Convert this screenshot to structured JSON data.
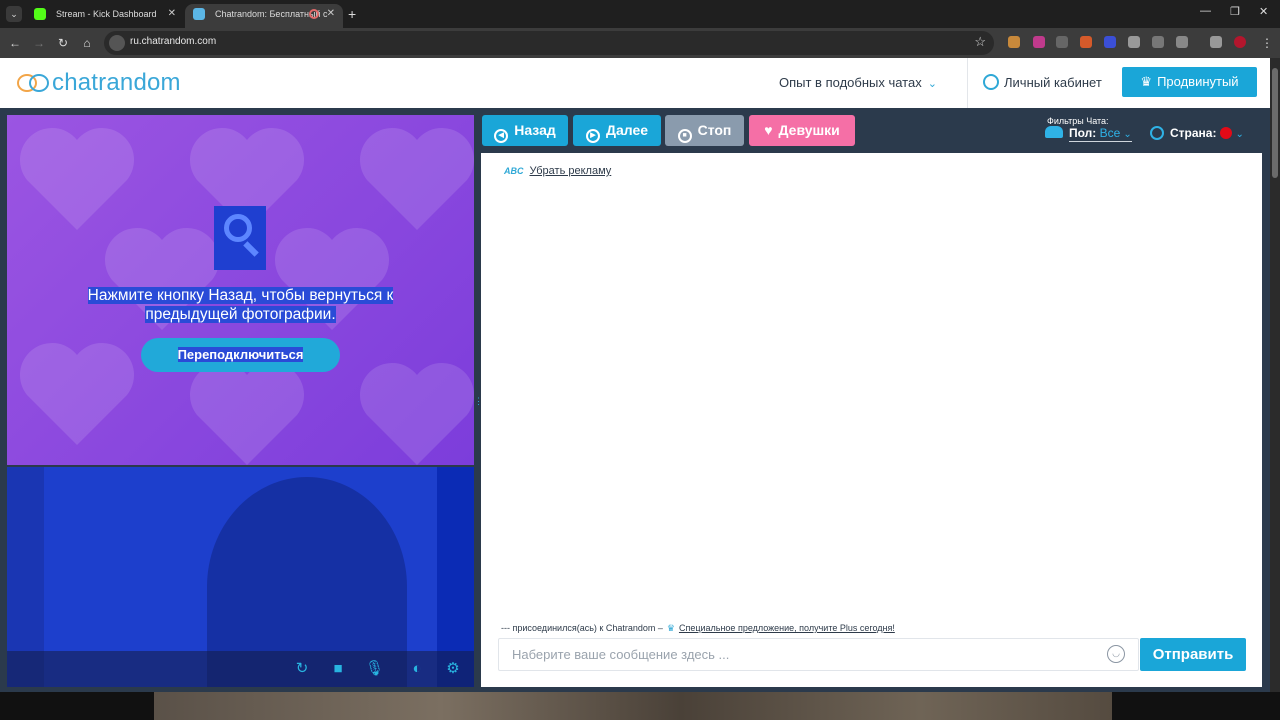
{
  "browser": {
    "tabs": [
      {
        "title": "Stream - Kick Dashboard",
        "favicon_color": "#53fc18",
        "active": false
      },
      {
        "title": "Chatrandom: Бесплатный с",
        "favicon_color": "#5bb6e6",
        "active": true
      }
    ],
    "url": "ru.chatrandom.com"
  },
  "header": {
    "logo_text": "chatrandom",
    "experience_menu": "Опыт в подобных чатах",
    "cabinet": "Личный кабинет",
    "advanced_button": "Продвинутый"
  },
  "video": {
    "remote_message_line1": "Нажмите кнопку Назад, чтобы вернуться к",
    "remote_message_line2": "предыдущей фотографии.",
    "reconnect_button": "Переподключиться",
    "controls": [
      "reconnect-icon",
      "camera-icon",
      "microphone-icon",
      "mask-icon",
      "settings-icon"
    ]
  },
  "chat_controls": {
    "back": "Назад",
    "next": "Далее",
    "stop": "Стоп",
    "girls": "Девушки",
    "filters_label": "Фильтры Чата:",
    "gender_label": "Пол:",
    "gender_value": "Все",
    "country_label": "Страна:"
  },
  "chat": {
    "remove_ads": "Убрать рекламу",
    "system_message": "--- присоединился(ась) к Chatrandom –",
    "offer_link": "Специальное предложение, получите Plus сегодня!",
    "input_placeholder": "Наберите ваше сообщение здесь ...",
    "send_button": "Отправить"
  },
  "colors": {
    "accent": "#1aa6d8",
    "back_button": "#1aa6d8",
    "next_button": "#1aa6d8",
    "stop_button": "#8a9bad",
    "girls_button": "#f56fa6",
    "remote_bg": "#8b48e0",
    "local_bg": "#1d3fcc"
  }
}
